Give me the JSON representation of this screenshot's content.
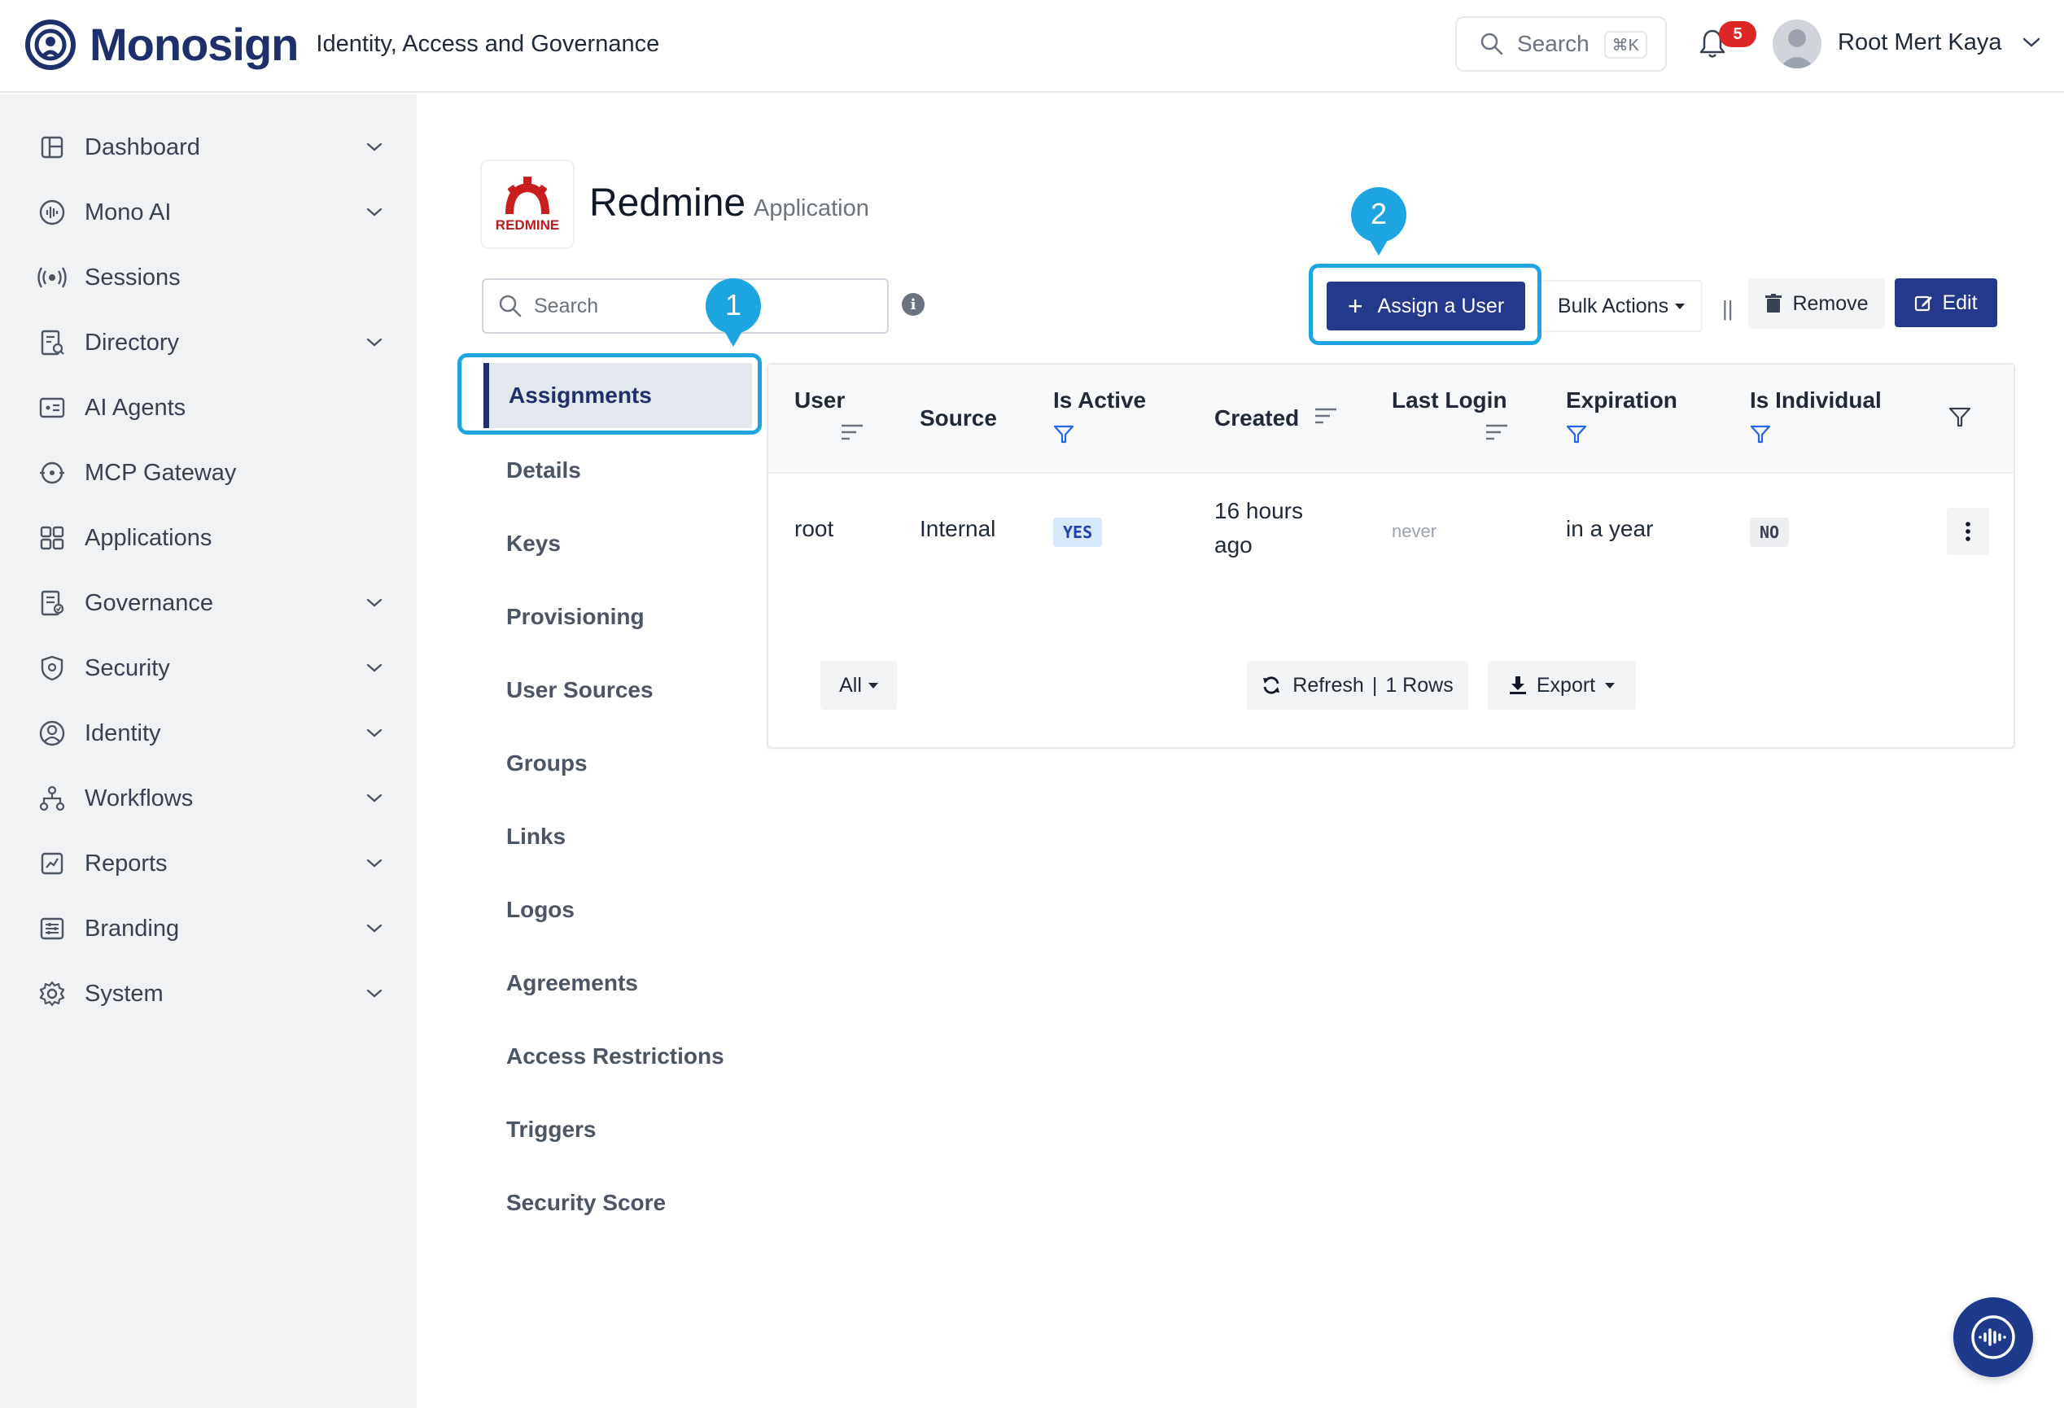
{
  "header": {
    "brand": "Monosign",
    "tagline": "Identity, Access and Governance",
    "search_label": "Search",
    "search_shortcut": "⌘K",
    "notification_count": "5",
    "user_name": "Root Mert Kaya"
  },
  "sidebar": {
    "items": [
      {
        "label": "Dashboard",
        "icon": "dashboard-icon",
        "expandable": true
      },
      {
        "label": "Mono AI",
        "icon": "ai-wave-icon",
        "expandable": true
      },
      {
        "label": "Sessions",
        "icon": "broadcast-icon",
        "expandable": false
      },
      {
        "label": "Directory",
        "icon": "directory-icon",
        "expandable": true
      },
      {
        "label": "AI Agents",
        "icon": "agent-icon",
        "expandable": false
      },
      {
        "label": "MCP Gateway",
        "icon": "gateway-icon",
        "expandable": false
      },
      {
        "label": "Applications",
        "icon": "apps-grid-icon",
        "expandable": false
      },
      {
        "label": "Governance",
        "icon": "governance-icon",
        "expandable": true
      },
      {
        "label": "Security",
        "icon": "shield-icon",
        "expandable": true
      },
      {
        "label": "Identity",
        "icon": "identity-icon",
        "expandable": true
      },
      {
        "label": "Workflows",
        "icon": "workflow-icon",
        "expandable": true
      },
      {
        "label": "Reports",
        "icon": "report-chart-icon",
        "expandable": true
      },
      {
        "label": "Branding",
        "icon": "branding-sliders-icon",
        "expandable": true
      },
      {
        "label": "System",
        "icon": "gear-icon",
        "expandable": true
      }
    ]
  },
  "app": {
    "logo_text": "REDMINE",
    "title": "Redmine",
    "subtitle": "Application"
  },
  "search": {
    "placeholder": "Search",
    "info_glyph": "i"
  },
  "tabs": [
    {
      "label": "Assignments",
      "active": true
    },
    {
      "label": "Details"
    },
    {
      "label": "Keys"
    },
    {
      "label": "Provisioning"
    },
    {
      "label": "User Sources"
    },
    {
      "label": "Groups"
    },
    {
      "label": "Links"
    },
    {
      "label": "Logos"
    },
    {
      "label": "Agreements"
    },
    {
      "label": "Access Restrictions"
    },
    {
      "label": "Triggers"
    },
    {
      "label": "Security Score"
    }
  ],
  "callouts": [
    "1",
    "2"
  ],
  "actions": {
    "assign": "Assign a User",
    "bulk": "Bulk Actions",
    "separator": "||",
    "remove": "Remove",
    "edit": "Edit"
  },
  "table": {
    "columns": [
      "User",
      "Source",
      "Is Active",
      "Created",
      "Last Login",
      "Expiration",
      "Is Individual"
    ],
    "rows": [
      {
        "user": "root",
        "source": "Internal",
        "is_active": "YES",
        "created_line1": "16 hours",
        "created_line2": "ago",
        "last_login": "never",
        "expiration": "in a year",
        "is_individual": "NO"
      }
    ],
    "footer": {
      "page_size": "All",
      "refresh": "Refresh",
      "row_count": "1 Rows",
      "export": "Export"
    }
  },
  "colors": {
    "primary": "#24398b",
    "callout": "#1da5e2",
    "badge_notification": "#dc2626",
    "brand": "#1e2f6b"
  }
}
